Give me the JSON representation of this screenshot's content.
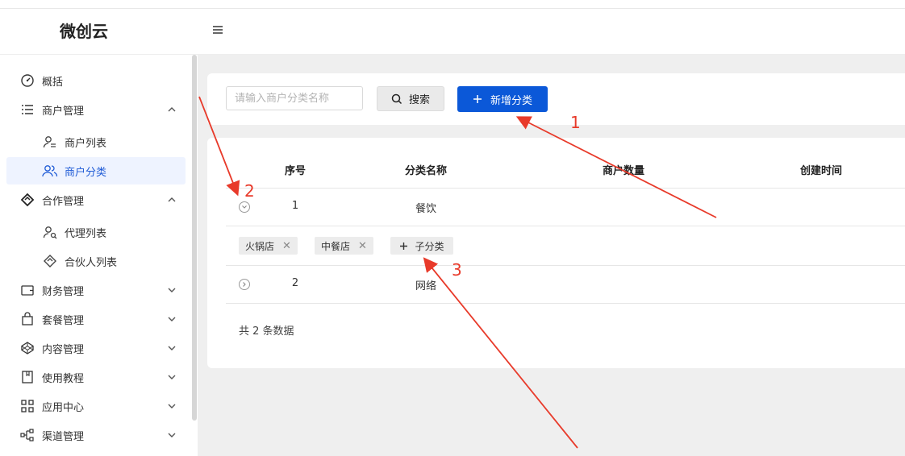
{
  "header": {
    "logo": "微创云",
    "menu_icon": "hamburger-icon"
  },
  "sidebar": {
    "items": [
      {
        "label": "概括",
        "icon": "gauge-icon"
      },
      {
        "label": "商户管理",
        "icon": "list-icon",
        "expanded": true
      },
      {
        "label": "商户列表",
        "icon": "user-list-icon"
      },
      {
        "label": "商户分类",
        "icon": "users-icon",
        "active": true
      },
      {
        "label": "合作管理",
        "icon": "handshake-icon",
        "expanded": true
      },
      {
        "label": "代理列表",
        "icon": "user-agent-icon"
      },
      {
        "label": "合伙人列表",
        "icon": "handshake-icon"
      },
      {
        "label": "财务管理",
        "icon": "wallet-icon"
      },
      {
        "label": "套餐管理",
        "icon": "bag-icon"
      },
      {
        "label": "内容管理",
        "icon": "codepen-icon"
      },
      {
        "label": "使用教程",
        "icon": "book-icon"
      },
      {
        "label": "应用中心",
        "icon": "apps-icon"
      },
      {
        "label": "渠道管理",
        "icon": "flow-icon"
      }
    ]
  },
  "search": {
    "placeholder": "请输入商户分类名称",
    "button_label": "搜索"
  },
  "add_button": {
    "label": "新增分类"
  },
  "table": {
    "columns": [
      "序号",
      "分类名称",
      "商户数量",
      "创建时间"
    ],
    "rows": [
      {
        "index": "1",
        "name": "餐饮",
        "expanded": true,
        "children": [
          "火锅店",
          "中餐店"
        ],
        "add_child_label": "子分类"
      },
      {
        "index": "2",
        "name": "网络",
        "expanded": false
      }
    ],
    "total_text": "共 2 条数据"
  },
  "annotations": {
    "a1": "1",
    "a2": "2",
    "a3": "3"
  },
  "colors": {
    "primary": "#0b58d8",
    "annotation": "#e83a2a",
    "active_bg": "#eef3ff"
  }
}
